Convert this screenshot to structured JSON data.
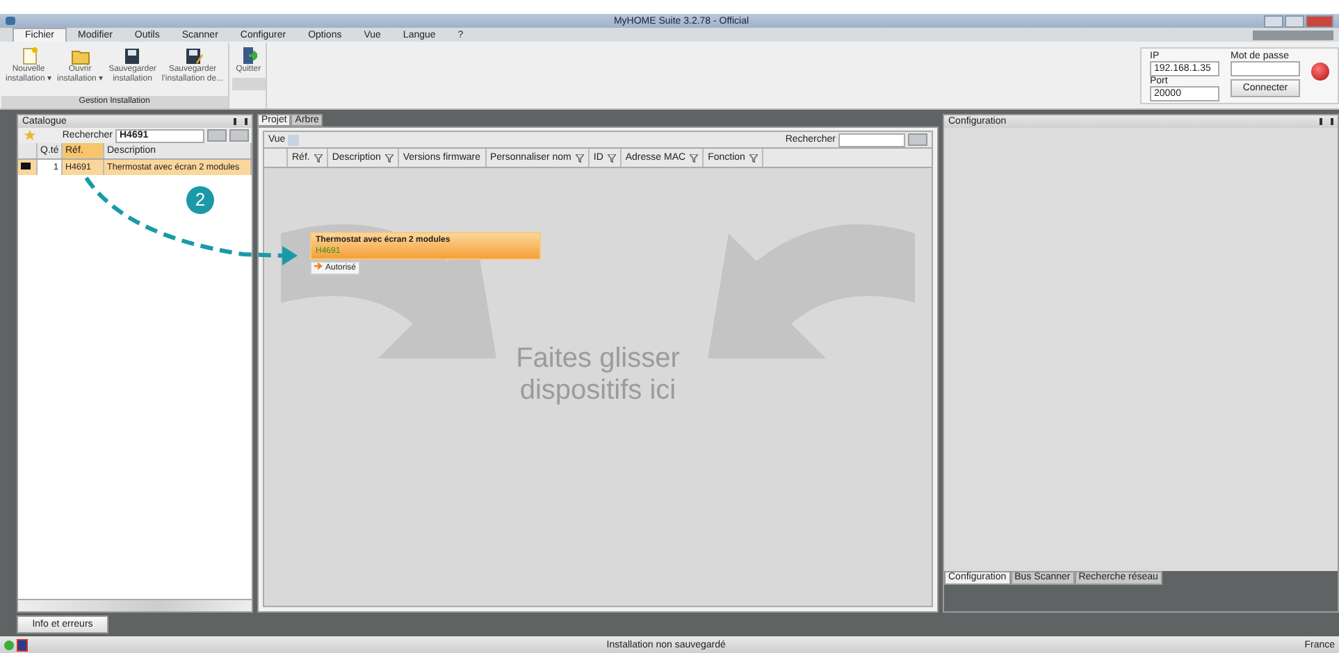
{
  "window": {
    "title": "MyHOME Suite 3.2.78 - Official"
  },
  "menu": [
    {
      "label": "Fichier",
      "selected": true
    },
    {
      "label": "Modifier",
      "selected": false
    },
    {
      "label": "Outils",
      "selected": false
    },
    {
      "label": "Scanner",
      "selected": false
    },
    {
      "label": "Configurer",
      "selected": false
    },
    {
      "label": "Options",
      "selected": false
    },
    {
      "label": "Vue",
      "selected": false
    },
    {
      "label": "Langue",
      "selected": false
    },
    {
      "label": "?",
      "selected": false
    }
  ],
  "ribbon": {
    "group": "Gestion Installation",
    "buttons": [
      {
        "kind": "new",
        "lines": [
          "Nouvelle",
          "installation ▾"
        ]
      },
      {
        "kind": "open",
        "lines": [
          "Ouvrir",
          "installation ▾"
        ]
      },
      {
        "kind": "save",
        "lines": [
          "Sauvegarder",
          "installation"
        ]
      },
      {
        "kind": "saveas",
        "lines": [
          "Sauvegarder",
          "l'installation de..."
        ]
      }
    ],
    "quit": {
      "lines": [
        "Quitter"
      ]
    }
  },
  "connection": {
    "ip_label": "IP",
    "ip": "192.168.1.35",
    "password_label": "Mot de passe",
    "port_label": "Port",
    "port": "20000",
    "connect": "Connecter",
    "connected": false
  },
  "catalogue": {
    "title": "Catalogue",
    "search_label": "Rechercher",
    "search": "H4691",
    "columns": [
      "Q.té",
      "Réf.",
      "Description"
    ],
    "rows": [
      {
        "qty": "1",
        "ref": "H4691",
        "description": "Thermostat avec écran 2 modules",
        "selected": true
      }
    ]
  },
  "project": {
    "tabs": [
      {
        "label": "Projet",
        "selected": true
      },
      {
        "label": "Arbre",
        "selected": false
      }
    ],
    "view_label": "Vue",
    "search_label": "Rechercher",
    "columns": [
      "Réf.",
      "Description",
      "Versions firmware",
      "Personnaliser nom",
      "ID",
      "Adresse MAC",
      "Fonction"
    ],
    "drop_hint": [
      "Faites glisser",
      "dispositifs ici"
    ],
    "device": {
      "title": "Thermostat avec écran 2 modules",
      "ref": "H4691",
      "status": "Autorisé"
    }
  },
  "configuration": {
    "title": "Configuration",
    "tabs": [
      {
        "label": "Configuration",
        "selected": true
      },
      {
        "label": "Bus Scanner",
        "selected": false
      },
      {
        "label": "Recherche réseau",
        "selected": false
      }
    ]
  },
  "step_badge": "2",
  "info_button": "Info et erreurs",
  "status_bar": {
    "message": "Installation non sauvegardé",
    "language": "France"
  }
}
